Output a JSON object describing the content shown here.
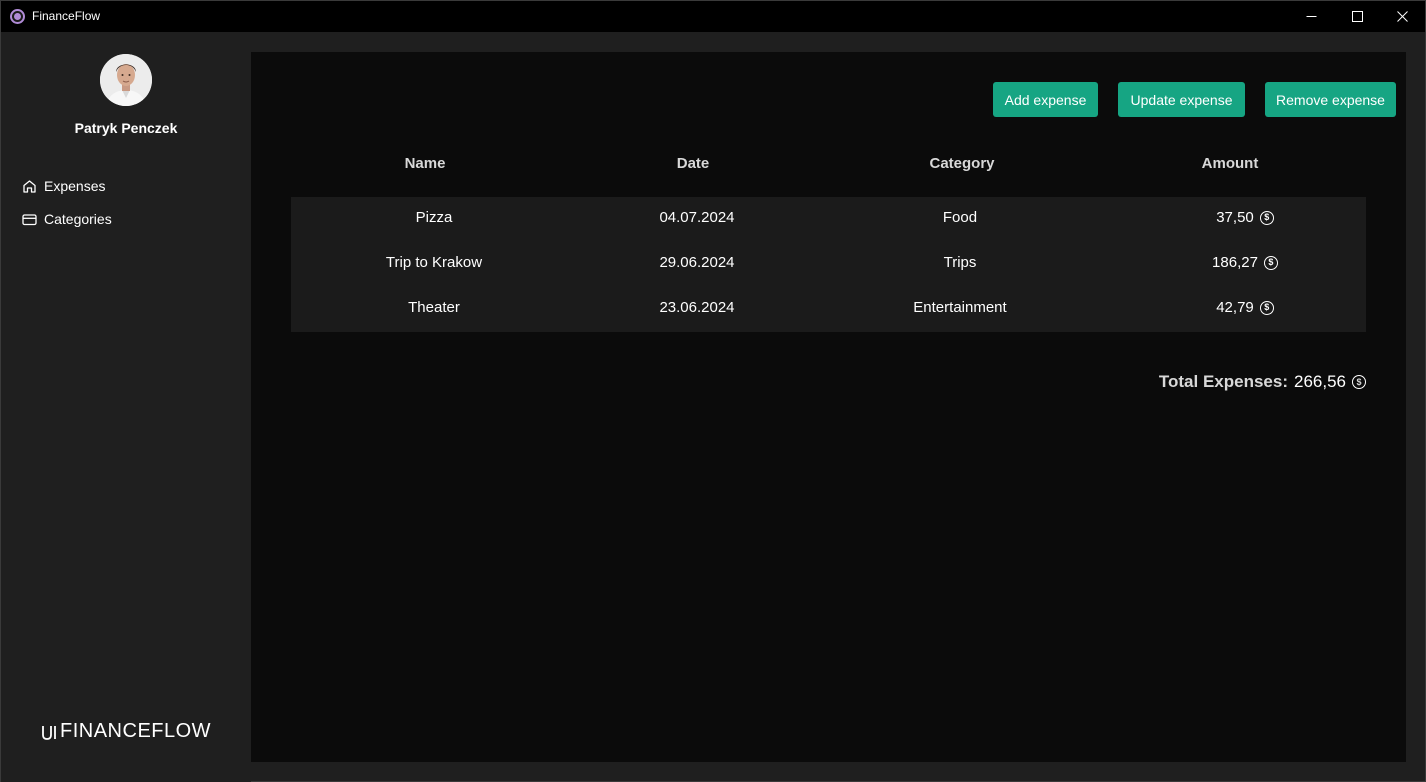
{
  "window": {
    "title": "FinanceFlow"
  },
  "sidebar": {
    "user_name": "Patryk Penczek",
    "items": [
      {
        "label": "Expenses",
        "icon": "home-icon"
      },
      {
        "label": "Categories",
        "icon": "credit-card-icon"
      }
    ],
    "brand": "FINANCEFLOW"
  },
  "toolbar": {
    "add_label": "Add expense",
    "update_label": "Update expense",
    "remove_label": "Remove expense",
    "accent_color": "#16a583"
  },
  "table": {
    "columns": [
      "Name",
      "Date",
      "Category",
      "Amount"
    ],
    "rows": [
      {
        "name": "Pizza",
        "date": "04.07.2024",
        "category": "Food",
        "amount": "37,50"
      },
      {
        "name": "Trip to Krakow",
        "date": "29.06.2024",
        "category": "Trips",
        "amount": "186,27"
      },
      {
        "name": "Theater",
        "date": "23.06.2024",
        "category": "Entertainment",
        "amount": "42,79"
      }
    ]
  },
  "summary": {
    "label": "Total Expenses:",
    "value": "266,56",
    "currency_icon": "dollar-coin-icon"
  }
}
